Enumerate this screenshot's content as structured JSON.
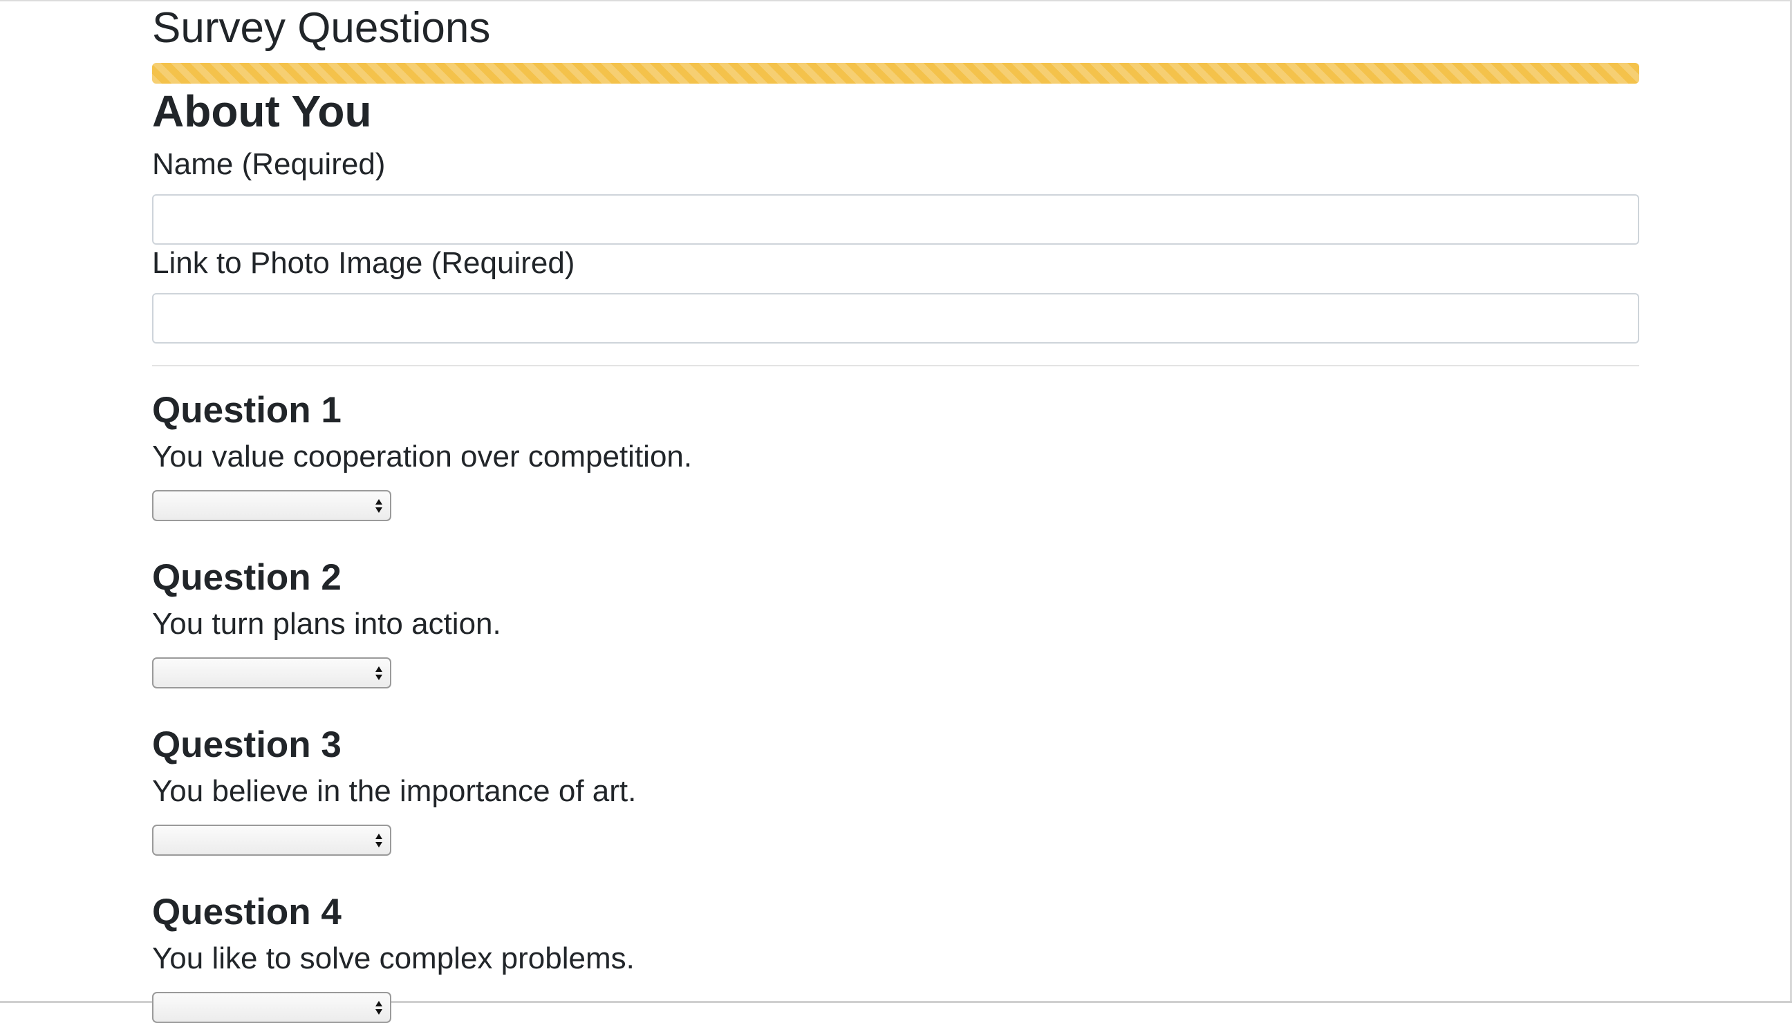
{
  "page": {
    "title": "Survey Questions",
    "progress_percent": 100,
    "progress_color": "#f4c24b"
  },
  "about": {
    "section_title": "About You",
    "name_label": "Name (Required)",
    "name_value": "",
    "photo_label": "Link to Photo Image (Required)",
    "photo_value": ""
  },
  "questions": [
    {
      "title": "Question 1",
      "text": "You value cooperation over competition.",
      "selected": ""
    },
    {
      "title": "Question 2",
      "text": "You turn plans into action.",
      "selected": ""
    },
    {
      "title": "Question 3",
      "text": "You believe in the importance of art.",
      "selected": ""
    },
    {
      "title": "Question 4",
      "text": "You like to solve complex problems.",
      "selected": ""
    }
  ]
}
